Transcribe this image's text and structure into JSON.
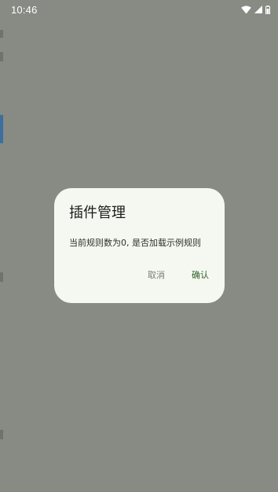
{
  "status_bar": {
    "time": "10:46",
    "icons": [
      "wifi-icon",
      "signal-icon",
      "battery-icon"
    ]
  },
  "dialog": {
    "title": "插件管理",
    "message": "当前规则数为0, 是否加载示例规则",
    "cancel_label": "取消",
    "confirm_label": "确认"
  },
  "colors": {
    "scrim": "#888a84",
    "dialog_background": "#f5f8f0",
    "confirm_text": "#2f5f2b",
    "cancel_text": "#7a7d77"
  }
}
